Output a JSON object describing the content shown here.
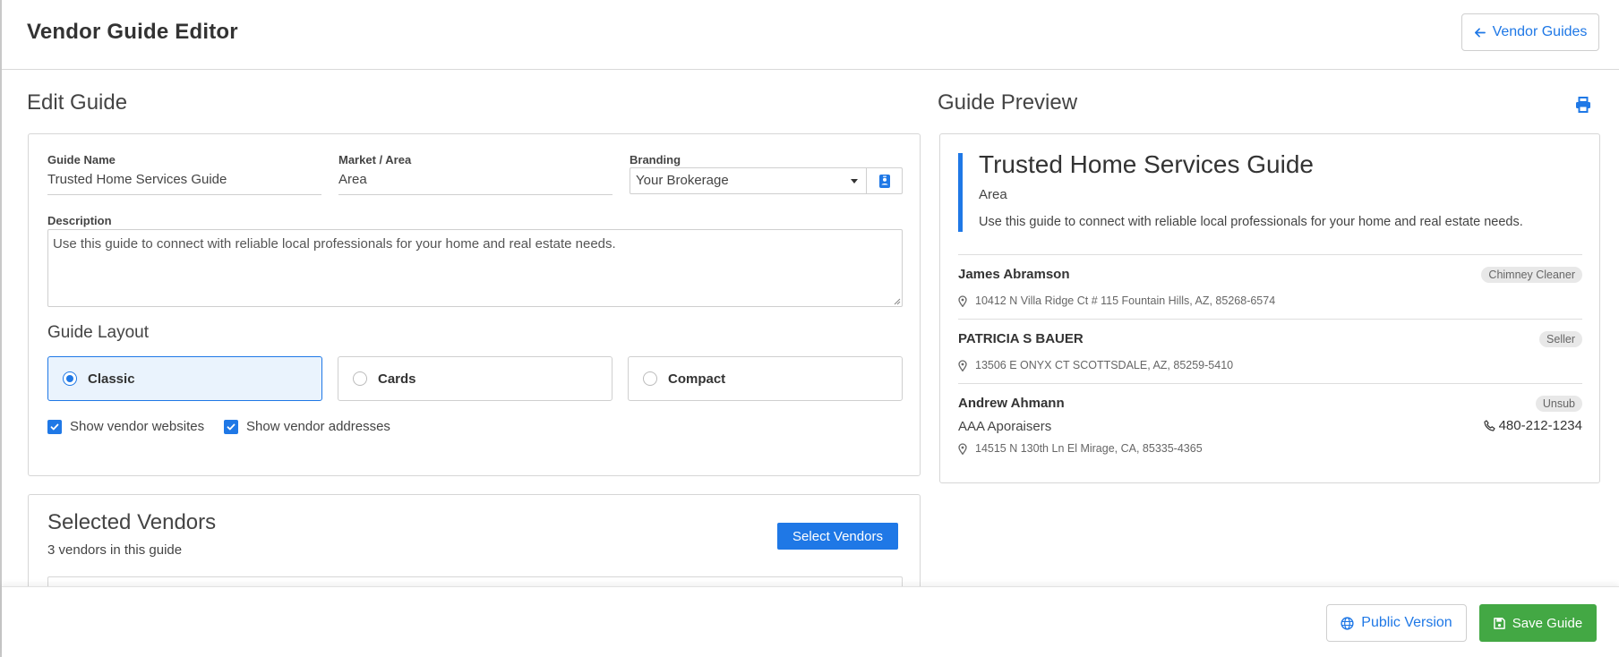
{
  "header": {
    "title": "Vendor Guide Editor",
    "back_button_label": "Vendor Guides"
  },
  "edit": {
    "section_title": "Edit Guide",
    "guide_name": {
      "label": "Guide Name",
      "value": "Trusted Home Services Guide"
    },
    "market_area": {
      "label": "Market / Area",
      "value": "Area"
    },
    "branding": {
      "label": "Branding",
      "value": "Your Brokerage"
    },
    "description": {
      "label": "Description",
      "value": "Use this guide to connect with reliable local professionals for your home and real estate needs."
    },
    "layout": {
      "title": "Guide Layout",
      "options": [
        {
          "label": "Classic",
          "selected": true
        },
        {
          "label": "Cards",
          "selected": false
        },
        {
          "label": "Compact",
          "selected": false
        }
      ]
    },
    "options": {
      "show_websites": {
        "label": "Show vendor websites",
        "checked": true
      },
      "show_addresses": {
        "label": "Show vendor addresses",
        "checked": true
      }
    }
  },
  "selected_vendors": {
    "title": "Selected Vendors",
    "subtitle": "3 vendors in this guide",
    "select_button_label": "Select Vendors"
  },
  "preview": {
    "section_title": "Guide Preview",
    "title": "Trusted Home Services Guide",
    "area": "Area",
    "description": "Use this guide to connect with reliable local professionals for your home and real estate needs.",
    "vendors": [
      {
        "name": "James Abramson",
        "badge": "Chimney Cleaner",
        "address": "10412 N Villa Ridge Ct # 115 Fountain Hills, AZ, 85268-6574"
      },
      {
        "name": "PATRICIA S BAUER",
        "badge": "Seller",
        "address": "13506 E ONYX CT SCOTTSDALE, AZ, 85259-5410"
      },
      {
        "name": "Andrew Ahmann",
        "badge": "Unsub",
        "company": "AAA Aporaisers",
        "phone": "480-212-1234",
        "address": "14515 N 130th Ln El Mirage, CA, 85335-4365"
      }
    ]
  },
  "footer": {
    "public_button_label": "Public Version",
    "save_button_label": "Save Guide"
  },
  "colors": {
    "accent": "#1f78e6",
    "save": "#43a844",
    "selected_layout_bg": "#eaf3fd"
  }
}
